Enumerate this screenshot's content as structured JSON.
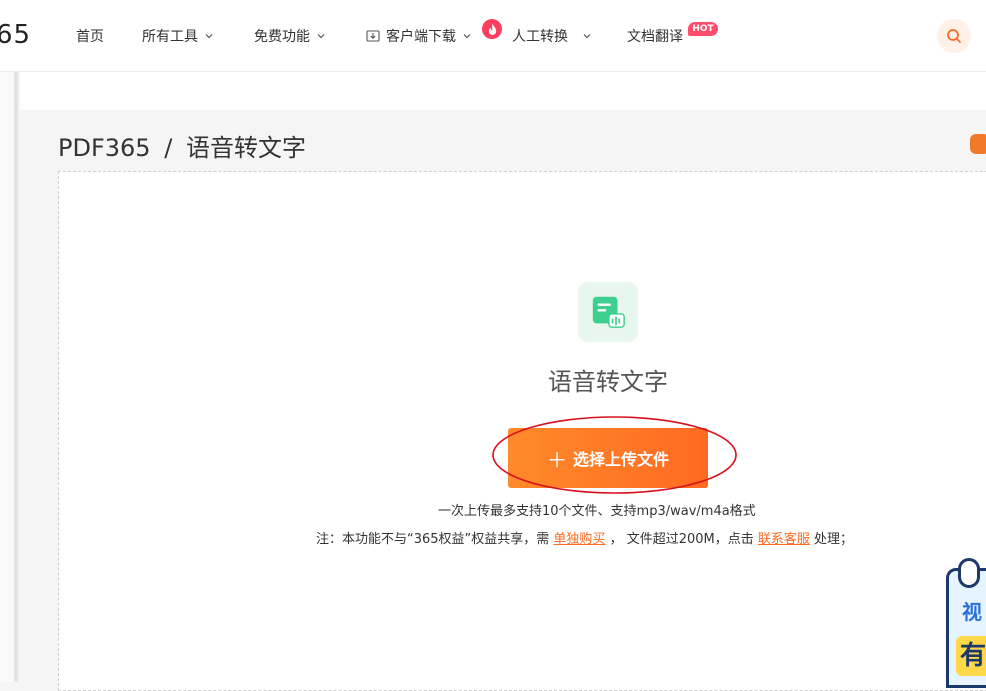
{
  "logo": {
    "text": "65"
  },
  "nav": {
    "home": "首页",
    "all_tools": "所有工具",
    "free": "免费功能",
    "download": "客户端下载",
    "manual": "人工转换",
    "translate": "文档翻译",
    "hot_badge": "HOT"
  },
  "breadcrumb": {
    "site": "PDF365",
    "sep": "/",
    "page": "语音转文字"
  },
  "tool": {
    "title": "语音转文字",
    "upload_label": "选择上传文件",
    "hint_limits": "一次上传最多支持10个文件、支持mp3/wav/m4a格式",
    "note_prefix": "注：本功能不与“365权益”权益共享，需 ",
    "buy_link": "单独购买",
    "note_mid": " ， 文件超过200M，点击 ",
    "service_link": "联系客服",
    "note_suffix": " 处理；"
  },
  "promo": {
    "line1": "视",
    "line2": "有"
  },
  "colors": {
    "accent": "#ff6a22",
    "icon_green": "#3ecf8e",
    "annotation_red": "#d8101c"
  }
}
